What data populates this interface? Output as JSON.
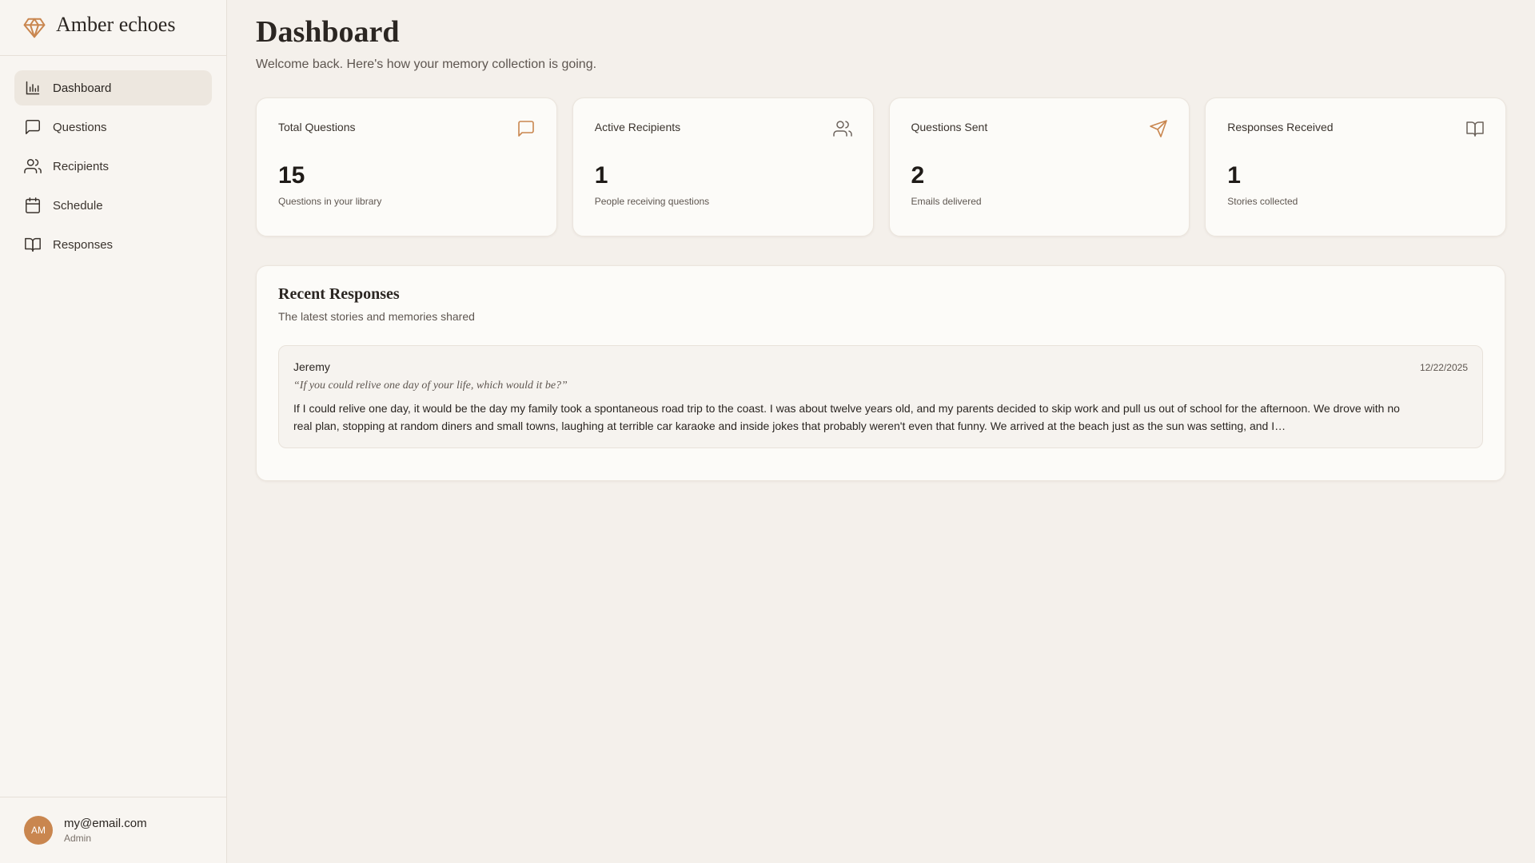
{
  "brand": {
    "name": "Amber echoes",
    "icon": "diamond-icon",
    "accent": "#c9864f"
  },
  "sidebar": {
    "items": [
      {
        "label": "Dashboard",
        "icon": "bar-chart-icon",
        "active": true
      },
      {
        "label": "Questions",
        "icon": "message-square-icon",
        "active": false
      },
      {
        "label": "Recipients",
        "icon": "users-icon",
        "active": false
      },
      {
        "label": "Schedule",
        "icon": "calendar-icon",
        "active": false
      },
      {
        "label": "Responses",
        "icon": "book-open-icon",
        "active": false
      }
    ]
  },
  "user": {
    "initials": "AM",
    "email": "my@email.com",
    "role": "Admin"
  },
  "header": {
    "title": "Dashboard",
    "subtitle": "Welcome back. Here's how your memory collection is going."
  },
  "stats": [
    {
      "label": "Total Questions",
      "value": "15",
      "desc": "Questions in your library",
      "icon": "message-square-icon"
    },
    {
      "label": "Active Recipients",
      "value": "1",
      "desc": "People receiving questions",
      "icon": "users-icon"
    },
    {
      "label": "Questions Sent",
      "value": "2",
      "desc": "Emails delivered",
      "icon": "send-icon"
    },
    {
      "label": "Responses Received",
      "value": "1",
      "desc": "Stories collected",
      "icon": "book-open-icon"
    }
  ],
  "recent": {
    "title": "Recent Responses",
    "subtitle": "The latest stories and memories shared",
    "items": [
      {
        "name": "Jeremy",
        "date": "12/22/2025",
        "question": "“If you could relive one day of your life, which would it be?”",
        "answer": "If I could relive one day, it would be the day my family took a spontaneous road trip to the coast. I was about twelve years old, and my parents decided to skip work and pull us out of school for the afternoon. We drove with no real plan, stopping at random diners and small towns, laughing at terrible car karaoke and inside jokes that probably weren't even that funny. We arrived at the beach just as the sun was setting, and I…"
      }
    ]
  }
}
